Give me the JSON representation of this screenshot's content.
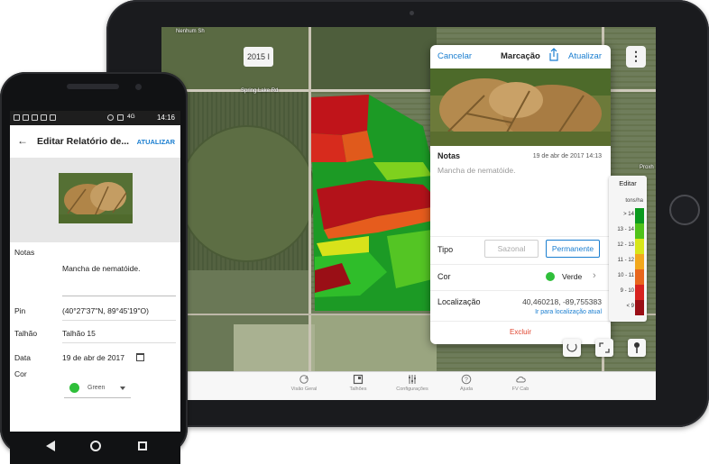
{
  "tablet": {
    "top_chip": "2015 I",
    "map": {
      "road_labels": [
        "Nenhum Sh",
        "Spring Lake Rd",
        "Proxh"
      ]
    },
    "popover": {
      "cancel_label": "Cancelar",
      "title": "Marcação",
      "share_icon": "share-icon",
      "update_label": "Atualizar",
      "notes_label": "Notas",
      "notes_date": "19 de abr de 2017 14:13",
      "notes_text": "Mancha de nematóide.",
      "tipo_label": "Tipo",
      "tipo_options": [
        "Sazonal",
        "Permanente"
      ],
      "tipo_selected": "Permanente",
      "cor_label": "Cor",
      "cor_value": "Verde",
      "cor_color": "#2fbf3a",
      "localizacao_label": "Localização",
      "localizacao_value": "40,460218, -89,755383",
      "localizacao_link": "Ir para localização atual",
      "delete_label": "Excluir"
    },
    "legend": {
      "edit_label": "Editar",
      "unit": "tons/ha",
      "rows": [
        {
          "label": "> 14",
          "color": "#0a9a1e"
        },
        {
          "label": "13 - 14",
          "color": "#4fc21a"
        },
        {
          "label": "12 - 13",
          "color": "#d7e61a"
        },
        {
          "label": "11 - 12",
          "color": "#f2a81c"
        },
        {
          "label": "10 - 11",
          "color": "#e8661d"
        },
        {
          "label": "9 - 10",
          "color": "#d8231f"
        },
        {
          "label": "< 9",
          "color": "#9a0f16"
        }
      ]
    },
    "tabs": [
      {
        "label": "Visão Geral",
        "icon": "refresh-icon"
      },
      {
        "label": "Talhões",
        "icon": "map-square-icon"
      },
      {
        "label": "Configurações",
        "icon": "sliders-icon"
      },
      {
        "label": "Ajuda",
        "icon": "help-icon"
      },
      {
        "label": "FV Cab",
        "icon": "cloud-icon"
      }
    ]
  },
  "phone": {
    "status": {
      "time": "14:16",
      "network": "4G"
    },
    "appbar": {
      "title": "Editar Relatório de...",
      "action": "ATUALIZAR"
    },
    "notes_label": "Notas",
    "notes_value": "Mancha de nematóide.",
    "pin_label": "Pin",
    "pin_value": "(40°27'37\"N, 89°45'19\"O)",
    "talhao_label": "Talhão",
    "talhao_value": "Talhão 15",
    "data_label": "Data",
    "data_value": "19 de abr de 2017",
    "cor_label": "Cor",
    "cor_value": "Green",
    "cor_color": "#2fbf3a"
  }
}
